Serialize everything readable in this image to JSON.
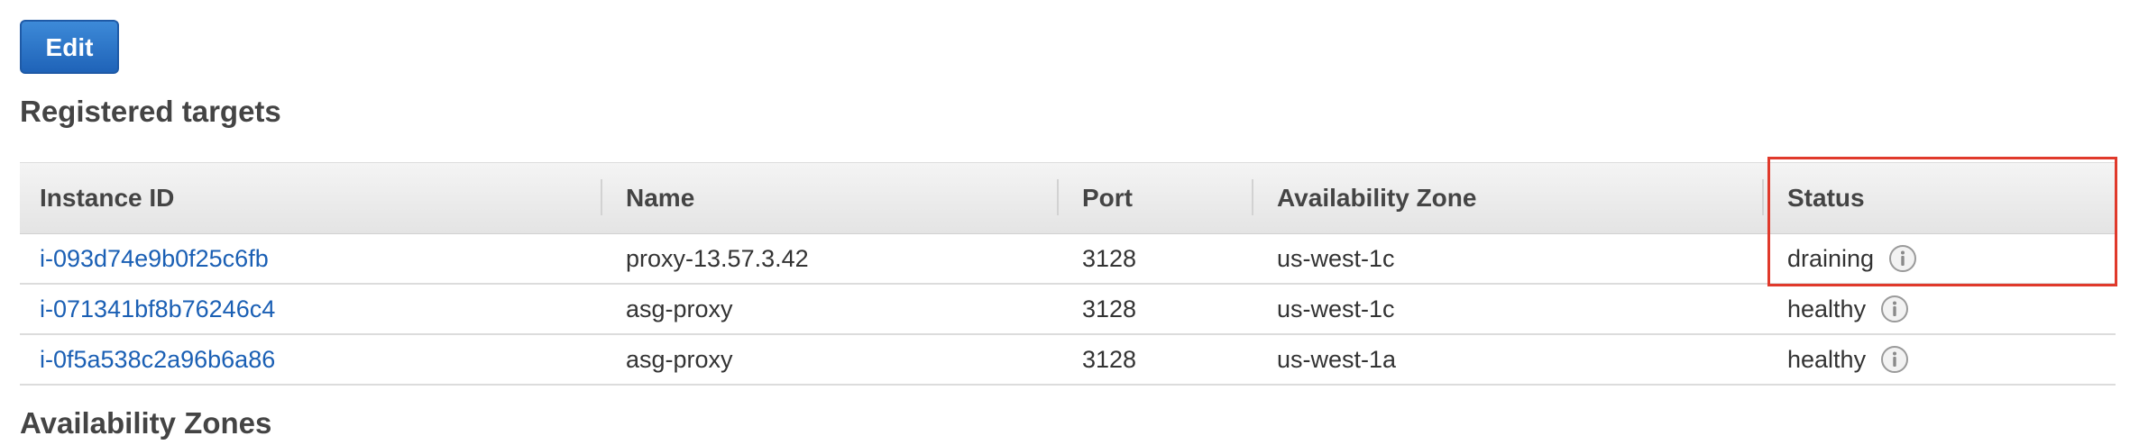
{
  "toolbar": {
    "edit_label": "Edit"
  },
  "registered_targets": {
    "title": "Registered targets",
    "columns": [
      "Instance ID",
      "Name",
      "Port",
      "Availability Zone",
      "Status"
    ],
    "rows": [
      {
        "instance_id": "i-093d74e9b0f25c6fb",
        "name": "proxy-13.57.3.42",
        "port": "3128",
        "zone": "us-west-1c",
        "status": "draining"
      },
      {
        "instance_id": "i-071341bf8b76246c4",
        "name": "asg-proxy",
        "port": "3128",
        "zone": "us-west-1c",
        "status": "healthy"
      },
      {
        "instance_id": "i-0f5a538c2a96b6a86",
        "name": "asg-proxy",
        "port": "3128",
        "zone": "us-west-1a",
        "status": "healthy"
      }
    ]
  },
  "availability_zones": {
    "title": "Availability Zones"
  },
  "colors": {
    "link": "#1a5fb4",
    "button": "#2a74c8",
    "highlight": "#e0392b"
  },
  "icons": {
    "status_info": "info-icon"
  }
}
